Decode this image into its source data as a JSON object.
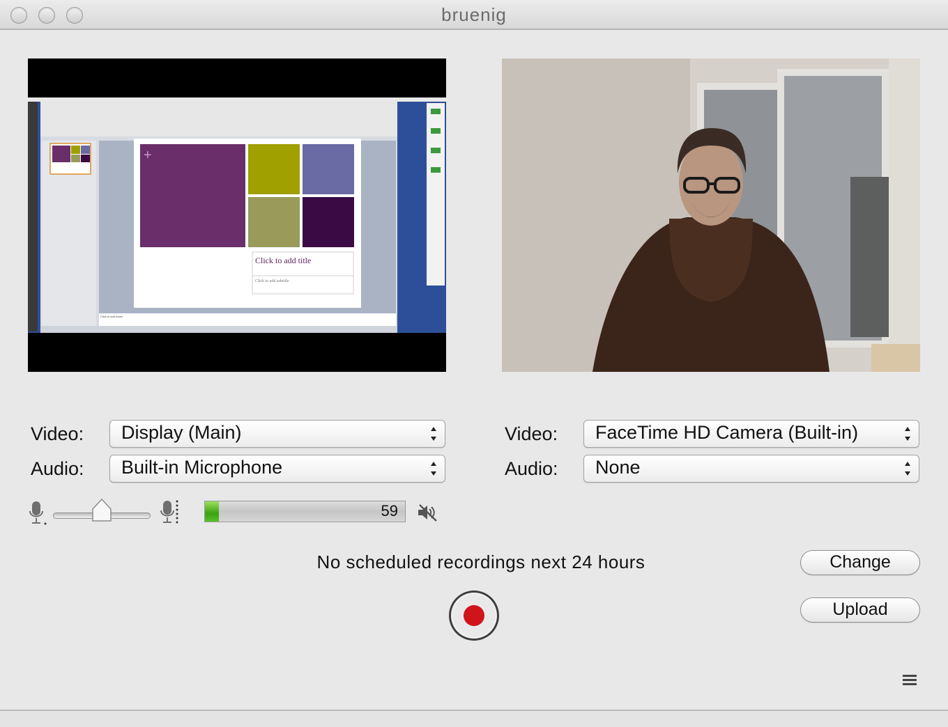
{
  "window": {
    "title": "bruenig"
  },
  "left_source": {
    "video_label": "Video:",
    "video_value": "Display (Main)",
    "audio_label": "Audio:",
    "audio_value": "Built-in Microphone",
    "screen_capture": {
      "slide_title": "Click to add title",
      "slide_subtitle": "Click to add subtitle",
      "notes_text": "Click to add notes"
    }
  },
  "right_source": {
    "video_label": "Video:",
    "video_value": "FaceTime HD Camera (Built-in)",
    "audio_label": "Audio:",
    "audio_value": "None"
  },
  "audio_controls": {
    "input_volume_fraction": 0.5,
    "level_value": "59",
    "level_fraction": 0.07,
    "icons": [
      "mic-low-icon",
      "mic-high-icon",
      "speaker-muted-icon"
    ]
  },
  "status": {
    "text": "No scheduled recordings next 24 hours"
  },
  "buttons": {
    "change": "Change",
    "upload": "Upload"
  },
  "record_button": {
    "icon": "record-icon",
    "color": "#d0141b"
  },
  "menu_icon": "menu-icon"
}
